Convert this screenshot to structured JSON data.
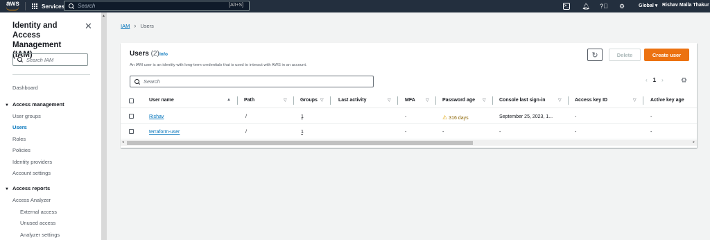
{
  "topnav": {
    "logo": "aws",
    "services_label": "Services",
    "search_placeholder": "Search",
    "search_shortcut": "[Alt+S]",
    "region": "Global ▾",
    "user": "Rishav Malla Thakur"
  },
  "sidebar": {
    "title": "Identity and Access Management (IAM)",
    "close": "✕",
    "search_placeholder": "Search IAM",
    "dashboard": "Dashboard",
    "access_management": {
      "heading": "Access management",
      "items": [
        "User groups",
        "Users",
        "Roles",
        "Policies",
        "Identity providers",
        "Account settings"
      ]
    },
    "access_reports": {
      "heading": "Access reports",
      "items": [
        "Access Analyzer"
      ],
      "sub_items": [
        "External access",
        "Unused access",
        "Analyzer settings"
      ]
    }
  },
  "breadcrumb": {
    "root": "IAM",
    "current": "Users"
  },
  "panel": {
    "title": "Users",
    "count": "(2)",
    "info": "Info",
    "description": "An IAM user is an identity with long-term credentials that is used to interact with AWS in an account.",
    "refresh_icon": "refresh-icon",
    "delete_label": "Delete",
    "create_label": "Create user",
    "search_placeholder": "Search",
    "page": "1",
    "columns": [
      "User name",
      "Path",
      "Groups",
      "Last activity",
      "MFA",
      "Password age",
      "Console last sign-in",
      "Access key ID",
      "Active key age"
    ],
    "rows": [
      {
        "user": "Rishav",
        "path": "/",
        "groups": "1",
        "last_activity": "-",
        "mfa": "-",
        "password_age": "316 days",
        "console": "September 25, 2023, 1...",
        "access_key": "-",
        "active_key_age": "-"
      },
      {
        "user": "terraform-user",
        "path": "/",
        "groups": "1",
        "last_activity": "-",
        "mfa": "-",
        "password_age": "-",
        "console": "-",
        "access_key": "-",
        "active_key_age": "-"
      }
    ]
  },
  "colors": {
    "accent": "#ec7211",
    "link": "#0073bb",
    "nav": "#232f3e"
  }
}
